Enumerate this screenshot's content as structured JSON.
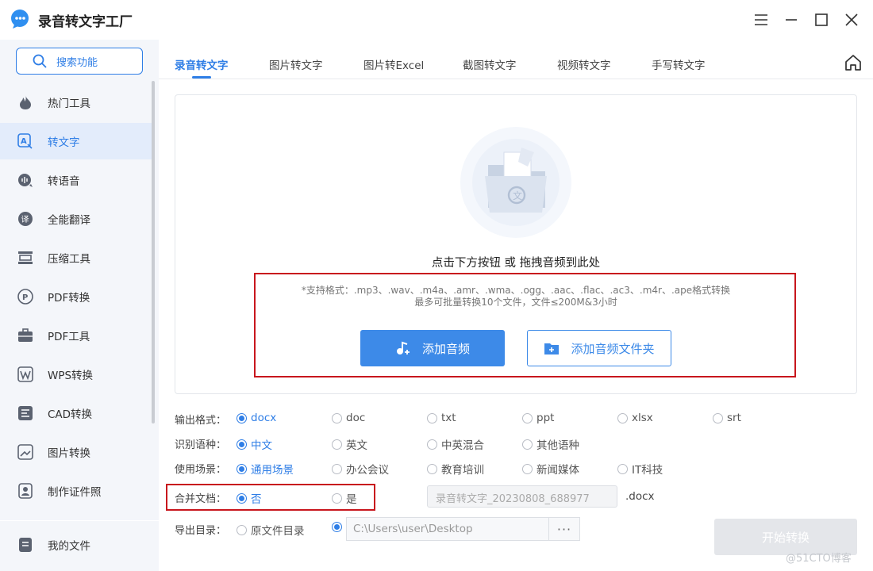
{
  "app": {
    "title": "录音转文字工厂"
  },
  "sidebar": {
    "search_label": "搜索功能",
    "items": [
      {
        "label": "热门工具",
        "icon": "fire-icon"
      },
      {
        "label": "转文字",
        "icon": "text-convert-icon",
        "active": true
      },
      {
        "label": "转语音",
        "icon": "voice-icon"
      },
      {
        "label": "全能翻译",
        "icon": "translate-icon"
      },
      {
        "label": "压缩工具",
        "icon": "compress-icon"
      },
      {
        "label": "PDF转换",
        "icon": "pdf-convert-icon"
      },
      {
        "label": "PDF工具",
        "icon": "toolbox-icon"
      },
      {
        "label": "WPS转换",
        "icon": "wps-icon"
      },
      {
        "label": "CAD转换",
        "icon": "cad-icon"
      },
      {
        "label": "图片转换",
        "icon": "image-icon"
      },
      {
        "label": "制作证件照",
        "icon": "id-photo-icon"
      }
    ],
    "my_files": "我的文件"
  },
  "tabs": [
    {
      "label": "录音转文字",
      "active": true
    },
    {
      "label": "图片转文字"
    },
    {
      "label": "图片转Excel"
    },
    {
      "label": "截图转文字"
    },
    {
      "label": "视频转文字"
    },
    {
      "label": "手写转文字"
    }
  ],
  "dropzone": {
    "hint": "点击下方按钮 或 拖拽音频到此处",
    "formats_line1": "*支持格式：.mp3、.wav、.m4a、.amr、.wma、.ogg、.aac、.flac、.ac3、.m4r、.ape格式转换",
    "formats_line2": "最多可批量转换10个文件，文件≤200M&3小时",
    "add_audio": "添加音频",
    "add_folder": "添加音频文件夹"
  },
  "options": {
    "output_format": {
      "label": "输出格式：",
      "choices": [
        "docx",
        "doc",
        "txt",
        "ppt",
        "xlsx",
        "srt"
      ],
      "selected": "docx"
    },
    "language": {
      "label": "识别语种：",
      "choices": [
        "中文",
        "英文",
        "中英混合",
        "其他语种"
      ],
      "selected": "中文"
    },
    "scene": {
      "label": "使用场景：",
      "choices": [
        "通用场景",
        "办公会议",
        "教育培训",
        "新闻媒体",
        "IT科技"
      ],
      "selected": "通用场景"
    },
    "merge": {
      "label": "合并文档：",
      "choices": [
        "否",
        "是"
      ],
      "selected": "否"
    },
    "filename_placeholder": "录音转文字_20230808_688977",
    "ext": ".docx",
    "export_dir": {
      "label": "导出目录：",
      "source_option": "原文件目录",
      "path": "C:\\Users\\user\\Desktop",
      "more": "···"
    }
  },
  "start_button": "开始转换",
  "watermark": "@51CTO博客",
  "colors": {
    "accent": "#2f7ee6",
    "button_blue": "#3d8ae8",
    "highlight_red": "#c8161d",
    "disabled": "#e4e6ea"
  }
}
